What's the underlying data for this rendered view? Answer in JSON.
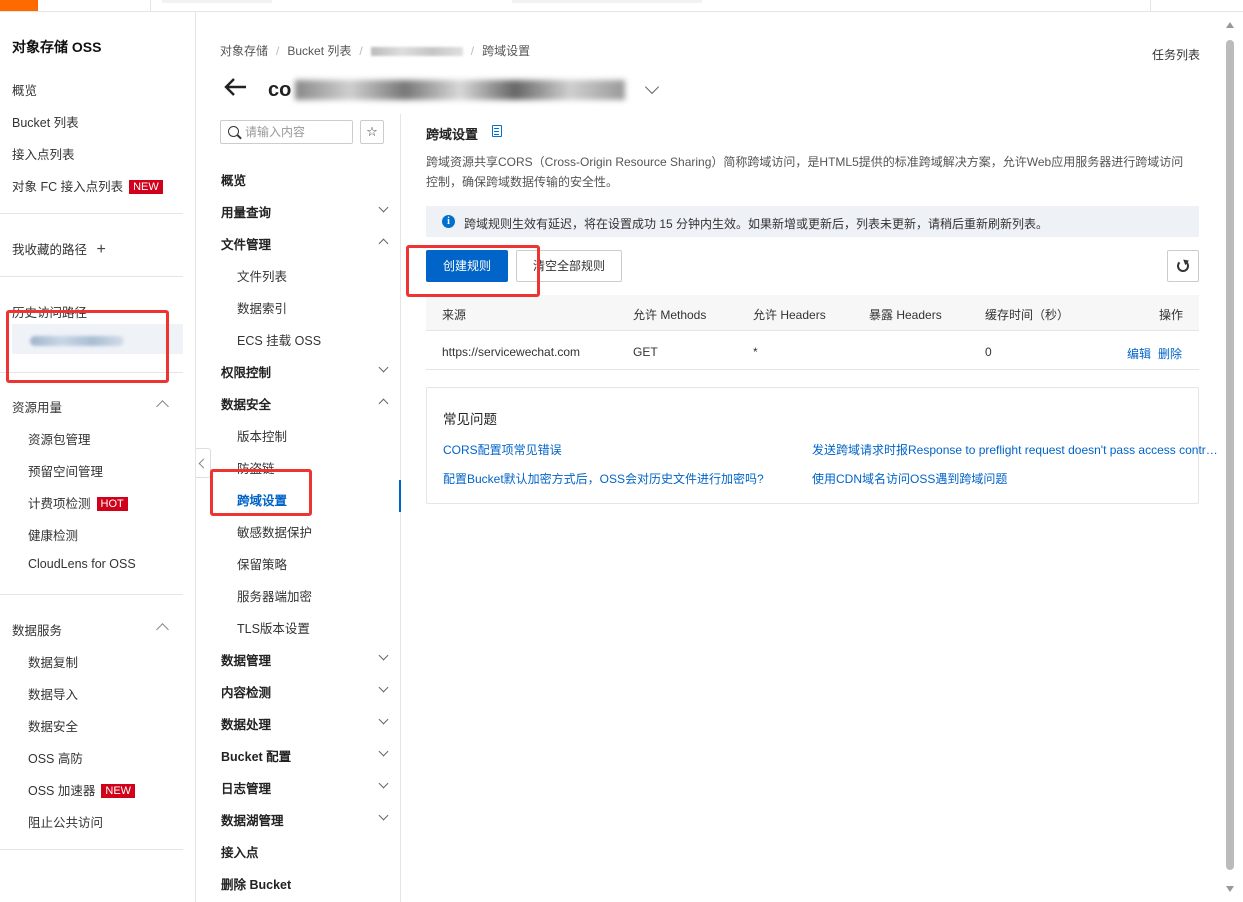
{
  "leftnav": {
    "title": "对象存储 OSS",
    "items": [
      "概览",
      "Bucket 列表",
      "接入点列表",
      "对象 FC 接入点列表"
    ],
    "fc_badge": "NEW",
    "favorites": "我收藏的路径",
    "favorites_add": "+",
    "history_title": "历史访问路径",
    "resource_title": "资源用量",
    "resource_items": [
      "资源包管理",
      "预留空间管理",
      "计费项检测",
      "健康检测",
      "CloudLens for OSS"
    ],
    "resource_badge": "HOT",
    "dataservice_title": "数据服务",
    "dataservice_items": [
      "数据复制",
      "数据导入",
      "数据安全",
      "OSS 高防",
      "OSS 加速器",
      "阻止公共访问"
    ],
    "accel_badge": "NEW"
  },
  "breadcrumb": [
    "对象存储",
    "Bucket 列表",
    "跨域设置"
  ],
  "header": {
    "title_prefix": "co",
    "task_list": "任务列表"
  },
  "secnav": {
    "search_placeholder": "请输入内容",
    "star": "☆",
    "groups": {
      "overview": "概览",
      "usage": "用量查询",
      "files": "文件管理",
      "perm": "权限控制",
      "security": "数据安全",
      "datamgmt": "数据管理",
      "content": "内容检测",
      "process": "数据处理",
      "config": "Bucket 配置",
      "logs": "日志管理",
      "lake": "数据湖管理",
      "access": "接入点",
      "delete": "删除 Bucket"
    },
    "file_items": [
      "文件列表",
      "数据索引",
      "ECS 挂载 OSS"
    ],
    "security_items": [
      "版本控制",
      "防盗链",
      "跨域设置",
      "敏感数据保护",
      "保留策略",
      "服务器端加密",
      "TLS版本设置"
    ]
  },
  "main": {
    "title": "跨域设置",
    "description": "跨域资源共享CORS（Cross-Origin Resource Sharing）简称跨域访问，是HTML5提供的标准跨域解决方案，允许Web应用服务器进行跨域访问控制，确保跨域数据传输的安全性。",
    "notice": "跨域规则生效有延迟，将在设置成功 15 分钟内生效。如果新增或更新后，列表未更新，请稍后重新刷新列表。",
    "create_button": "创建规则",
    "clear_button": "清空全部规则",
    "table": {
      "headers": [
        "来源",
        "允许 Methods",
        "允许 Headers",
        "暴露 Headers",
        "缓存时间（秒）",
        "操作"
      ],
      "rows": [
        {
          "origin": "https://servicewechat.com",
          "methods": "GET",
          "allow_headers": "*",
          "expose_headers": "",
          "max_age": "0",
          "edit": "编辑",
          "delete": "删除"
        }
      ]
    },
    "faq": {
      "title": "常见问题",
      "links": [
        "CORS配置项常见错误",
        "发送跨域请求时报Response to preflight request doesn't pass access contr…",
        "配置Bucket默认加密方式后，OSS会对历史文件进行加密吗?",
        "使用CDN域名访问OSS遇到跨域问题"
      ]
    }
  },
  "colors": {
    "primary": "#0064c8",
    "badge": "#d0021b",
    "highlight": "#e33333",
    "brand": "#ff6a00"
  }
}
